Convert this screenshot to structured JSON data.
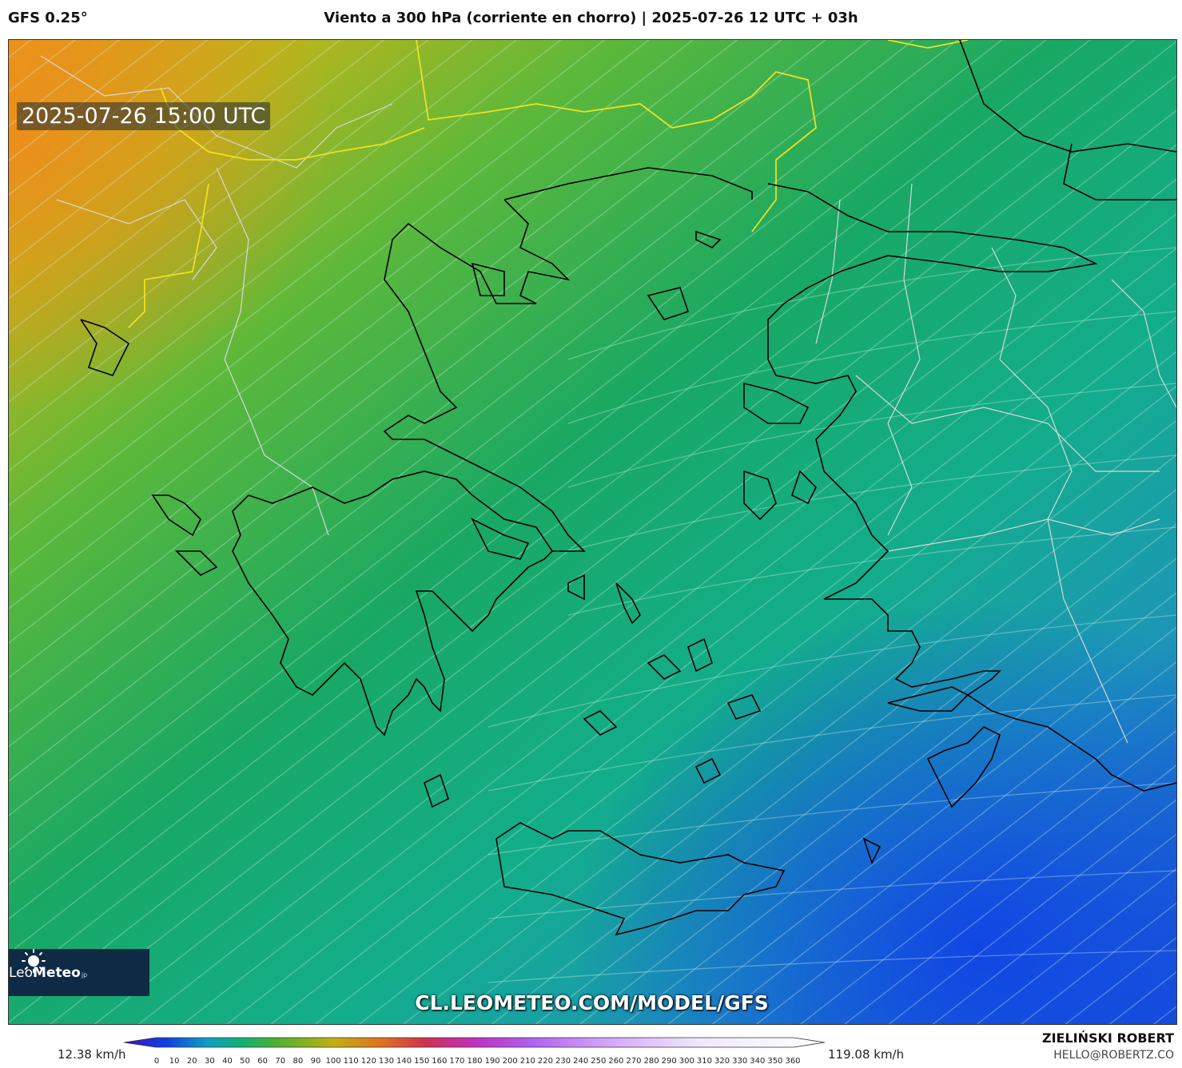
{
  "header": {
    "model": "GFS 0.25°",
    "title": "Viento a 300 hPa (corriente en chorro) | 2025-07-26 12 UTC + 03h"
  },
  "map": {
    "valid_time": "2025-07-26 15:00 UTC",
    "site_url": "CL.LEOMETEO.COM/MODEL/GFS",
    "logo": {
      "brand_light": "Leo",
      "brand_bold": "Meteo",
      "suffix": "jp"
    },
    "field": "wind speed at 300 hPa",
    "colors": {
      "strong_northwest": "#e8a020",
      "moderate": "#18a860",
      "weak_southeast": "#1048e0",
      "streamline": "#c8f0e0",
      "coastline": "#000000",
      "border_country": "#d8d8d8",
      "border_highlight": "#e8e020"
    }
  },
  "legend": {
    "unit": "km/h",
    "min_label": "12.38 km/h",
    "max_label": "119.08 km/h",
    "ticks": [
      "0",
      "10",
      "20",
      "30",
      "40",
      "50",
      "60",
      "70",
      "80",
      "90",
      "100",
      "110",
      "120",
      "130",
      "140",
      "150",
      "160",
      "170",
      "180",
      "190",
      "200",
      "210",
      "220",
      "230",
      "240",
      "250",
      "260",
      "270",
      "280",
      "290",
      "300",
      "310",
      "320",
      "330",
      "340",
      "350",
      "360"
    ],
    "gradient_stops": [
      "#4010c0",
      "#1040e0",
      "#10a0c0",
      "#10b070",
      "#50b030",
      "#c0b010",
      "#e07020",
      "#d03050",
      "#c030c0",
      "#b060f0",
      "#d0a0f8",
      "#f0e8ff",
      "#ffffff"
    ]
  },
  "credits": {
    "author": "ZIELIŃSKI ROBERT",
    "email": "HELLO@ROBERTZ.CO"
  }
}
